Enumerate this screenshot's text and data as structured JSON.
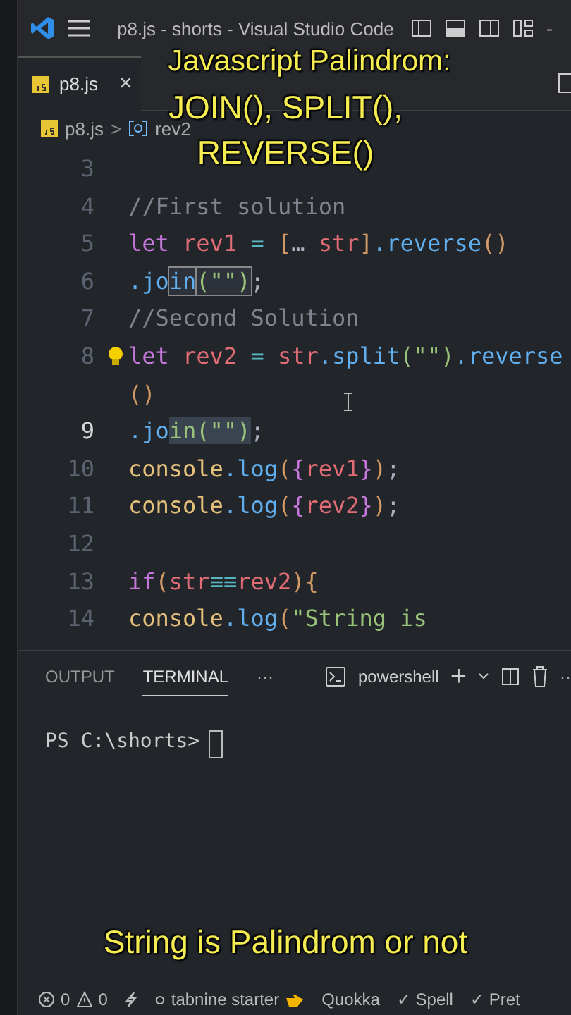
{
  "window": {
    "title": "p8.js - shorts - Visual Studio Code",
    "cut_control": "-"
  },
  "tabs": [
    {
      "label": "p8.js",
      "selected": true,
      "close": "×"
    }
  ],
  "breadcrumb": {
    "file": "p8.js",
    "separator": ">",
    "symbol": "rev2"
  },
  "editor": {
    "lines": [
      {
        "number": "3",
        "current": false
      },
      {
        "number": "4",
        "current": false,
        "tokens": [
          {
            "text": "//First solution",
            "kind": "comment"
          }
        ]
      },
      {
        "number": "5",
        "current": false,
        "tokens": [
          {
            "text": "let",
            "kind": "keyword"
          },
          {
            "text": " rev1 ",
            "kind": "variable"
          },
          {
            "text": "=",
            "kind": "operator"
          },
          {
            "text": " [",
            "kind": "bracket"
          },
          {
            "text": "…",
            "kind": "plain"
          },
          {
            "text": " str",
            "kind": "variable"
          },
          {
            "text": "]",
            "kind": "bracket"
          },
          {
            "text": ".reverse",
            "kind": "method"
          },
          {
            "text": "()",
            "kind": "bracket"
          }
        ]
      },
      {
        "number": "6",
        "current": false,
        "tokens": [
          {
            "text": ".jo",
            "kind": "method"
          },
          {
            "text": "in",
            "kind": "method",
            "outlined": true
          },
          {
            "text": "(\"\")",
            "kind": "string",
            "outlined": true
          },
          {
            "text": ";",
            "kind": "plain"
          }
        ]
      },
      {
        "number": "7",
        "current": false,
        "tokens": [
          {
            "text": "//Second Solution",
            "kind": "comment"
          }
        ]
      },
      {
        "number": "8",
        "current": false,
        "bulb": true,
        "tokens": [
          {
            "text": "let",
            "kind": "keyword"
          },
          {
            "text": " rev2 ",
            "kind": "variable"
          },
          {
            "text": "=",
            "kind": "operator"
          },
          {
            "text": " str",
            "kind": "variable"
          },
          {
            "text": ".split",
            "kind": "method"
          },
          {
            "text": "(\"\")",
            "kind": "string"
          },
          {
            "text": ".reverse",
            "kind": "method"
          }
        ]
      },
      {
        "tokens": [
          {
            "text": "()",
            "kind": "bracket"
          }
        ]
      },
      {
        "number": "9",
        "current": true,
        "tokens": [
          {
            "text": ".jo",
            "kind": "method"
          },
          {
            "text": "in(\"\")",
            "kind": "string",
            "highlighted": true
          },
          {
            "text": ";",
            "kind": "plain"
          }
        ]
      },
      {
        "number": "10",
        "current": false,
        "tokens": [
          {
            "text": "console",
            "kind": "object"
          },
          {
            "text": ".log",
            "kind": "method"
          },
          {
            "text": "(",
            "kind": "bracket"
          },
          {
            "text": "{",
            "kind": "keyword"
          },
          {
            "text": "rev1",
            "kind": "variable"
          },
          {
            "text": "}",
            "kind": "keyword"
          },
          {
            "text": ")",
            "kind": "bracket"
          },
          {
            "text": ";",
            "kind": "plain"
          }
        ]
      },
      {
        "number": "11",
        "current": false,
        "tokens": [
          {
            "text": "console",
            "kind": "object"
          },
          {
            "text": ".log",
            "kind": "method"
          },
          {
            "text": "(",
            "kind": "bracket"
          },
          {
            "text": "{",
            "kind": "keyword"
          },
          {
            "text": "rev2",
            "kind": "variable"
          },
          {
            "text": "}",
            "kind": "keyword"
          },
          {
            "text": ")",
            "kind": "bracket"
          },
          {
            "text": ";",
            "kind": "plain"
          }
        ]
      },
      {
        "number": "12",
        "current": false
      },
      {
        "number": "13",
        "current": false,
        "tokens": [
          {
            "text": "if",
            "kind": "keyword"
          },
          {
            "text": "(",
            "kind": "bracket"
          },
          {
            "text": "str",
            "kind": "variable"
          },
          {
            "text": "≡≡",
            "kind": "operator"
          },
          {
            "text": "rev2",
            "kind": "variable"
          },
          {
            "text": "){",
            "kind": "bracket"
          }
        ]
      },
      {
        "number": "14",
        "current": false,
        "tokens": [
          {
            "text": "console",
            "kind": "object"
          },
          {
            "text": ".log",
            "kind": "method"
          },
          {
            "text": "(",
            "kind": "bracket"
          },
          {
            "text": "\"String is",
            "kind": "string"
          }
        ]
      }
    ]
  },
  "panel": {
    "tabs": [
      {
        "label": "OUTPUT",
        "selected": false
      },
      {
        "label": "TERMINAL",
        "selected": true
      }
    ],
    "more": "···",
    "shell": "powershell",
    "add": "+",
    "more_right": "··",
    "prompt": "PS C:\\shorts>"
  },
  "status_bar": {
    "errors": "0",
    "warnings": "0",
    "tabnine": "tabnine starter",
    "items": [
      "Quokka",
      "✓ Spell",
      "✓ Pret"
    ]
  },
  "captions": {
    "top": [
      "Javascript Palindrom:",
      "JOIN(), SPLIT(),",
      "REVERSE()"
    ],
    "bottom": "String is Palindrom or not"
  }
}
